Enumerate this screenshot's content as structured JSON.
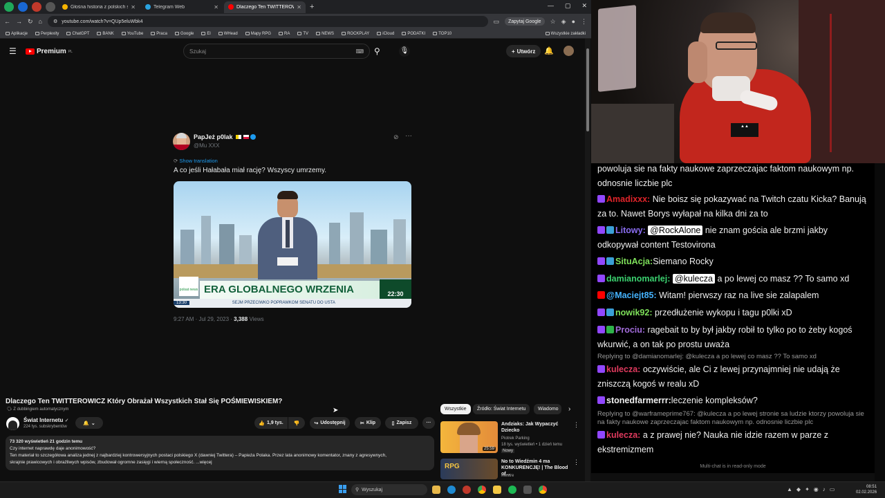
{
  "browser": {
    "tabs": [
      {
        "label": "Głośna historia z polskich socia",
        "color": "#f5b400"
      },
      {
        "label": "Telegram Web",
        "color": "#2aa3e0"
      },
      {
        "label": "Dlaczego Ten TWITTEROWICZ",
        "color": "#ff0000",
        "active": true
      }
    ],
    "url": "youtube.com/watch?v=QUp5eluWbk4",
    "ask_google": "Zapytaj Google",
    "bookmarks": [
      "Aplikacje",
      "Perplexity",
      "ChatGPT",
      "BANK",
      "YouTube",
      "Praca",
      "Google",
      "El",
      "WHead",
      "Mapy RPG",
      "RA",
      "TV",
      "NEWS",
      "ROCKPLAY",
      "iCloud",
      "PODATKI",
      "TOP10"
    ],
    "all_bookmarks": "Wszystkie zakładki"
  },
  "youtube": {
    "logo": "Premium",
    "logo_sup": "PL",
    "search_placeholder": "Szukaj",
    "create_label": "Utwórz",
    "tweet": {
      "name": "PapJeż p0lak",
      "handle": "@Mu                XXX",
      "show_translation": "Show translation",
      "text": "A co jeśli Hałabała miał rację? Wszyscy umrzemy.",
      "banner": "ERA GLOBALNEGO WRZENIA",
      "channel_logo": "polsat news",
      "clock": "13:30",
      "clock2": "22:30",
      "ticker": "SEJM PRZECIWKO POPRAWKOM SENATU DO USTA",
      "time": "9:27 AM · Jul 29, 2023 · ",
      "views_count": "3,388",
      "views_label": "Views"
    },
    "video": {
      "title": "Dlaczego Ten TWITTEROWICZ Który Obrażał Wszystkich Stał Się POŚMIEWISKIEM?",
      "dubbing": "Z dubbingiem automatycznym",
      "channel": "Świat Internetu",
      "subs": "224 tys. subskrybentów",
      "likes": "1,9 tys.",
      "share": "Udostępnij",
      "clip": "Klip",
      "save": "Zapisz",
      "views_line": "73 320 wyświetleń  21 godzin temu",
      "desc1": "Czy internet naprawdę daje anonimowość?",
      "desc2": "Ten materiał to szczegółowa analiza jednej z najbardziej kontrowersyjnych postaci polskiego X (dawniej Twittera) – Papieża Polaka. Przez lata anonimowy komentator, znany z agresywnych,",
      "desc3": "skrajnie prawicowych i obraźliwych wpisów, zbudował ogromne zasięgi i wierną społeczność. ...więcej"
    },
    "chips": [
      "Wszystkie",
      "Źródło: Świat Internetu",
      "Wiadomo"
    ],
    "related": [
      {
        "title": "Andziaks: Jak Wypaczyć Dziecko",
        "channel": "Piotrek Parking",
        "meta": "18 tys. wyświetleń • 1 dzień temu",
        "badge": "Nowy",
        "duration": "25:59"
      },
      {
        "title": "No to Wiedźmin 4 ma KONKURENCJĘ! | The Blood of...",
        "channel": "Mestre",
        "meta": "",
        "badge": "",
        "duration": ""
      }
    ]
  },
  "chat": {
    "messages": [
      {
        "user": "",
        "text": "powoluja sie na fakty naukowe zaprzeczajac faktom naukowym np. odnosnie liczbie plc",
        "color": "#f0f0f0"
      },
      {
        "user": "Amadixxx:",
        "text": "Nie boisz się pokazywać na Twitch czatu Kicka? Banują za to. Nawet Borys wyłapał na kilka dni za to",
        "color": "#e0242a"
      },
      {
        "user": "Litowy:",
        "mention": "@RockAlone",
        "text": "nie znam gościa ale brzmi jakby odkopywał content Testovirona",
        "color": "#8a6df0"
      },
      {
        "user": "SituAcja:",
        "text": "Siemano Rocky",
        "color": "#7ee05a"
      },
      {
        "user": "damianomarlej:",
        "mention": "@kulecza",
        "text": "a po lewej co masz ?? To samo xd",
        "color": "#3bd16f"
      },
      {
        "user": "@Maciejt85:",
        "text": "Witam! pierwszy raz na live sie zalapalem",
        "color": "#45b4ff"
      },
      {
        "user": "nowik92:",
        "text": "przedłużenie wykopu i tagu p0lki xD",
        "color": "#7ee05a"
      },
      {
        "user": "Prociu:",
        "text": "ragebait to by był jakby robił to tylko po to żeby kogoś wkurwić, a on tak po prostu uważa",
        "color": "#a06bd8"
      },
      {
        "reply": "Replying to @damianomarlej: @kulecza a po lewej co masz ?? To samo xd"
      },
      {
        "user": "kulecza:",
        "text": "oczywiście, ale Ci z lewej przynajmniej nie udają że zniszczą kogoś w realu xD",
        "color": "#e03a5e"
      },
      {
        "user": "stonedfarmerrr:",
        "text": "leczenie kompleksów?",
        "color": "#f0f0f0"
      },
      {
        "reply": "Replying to @warframeprime767: @kulecza a po lewej stronie sa ludzie ktorzy powoluja sie na fakty naukowe zaprzeczajac faktom naukowym np. odnosnie liczbie plc"
      },
      {
        "user": "kulecza:",
        "text": "a z prawej nie? Nauka nie idzie razem w parze z ekstremizmem",
        "color": "#e03a5e"
      }
    ],
    "footer": "Multi-chat is in read-only mode"
  },
  "taskbar": {
    "search": "Wyszukaj",
    "time": "08:51",
    "date": "02.02.2026"
  }
}
